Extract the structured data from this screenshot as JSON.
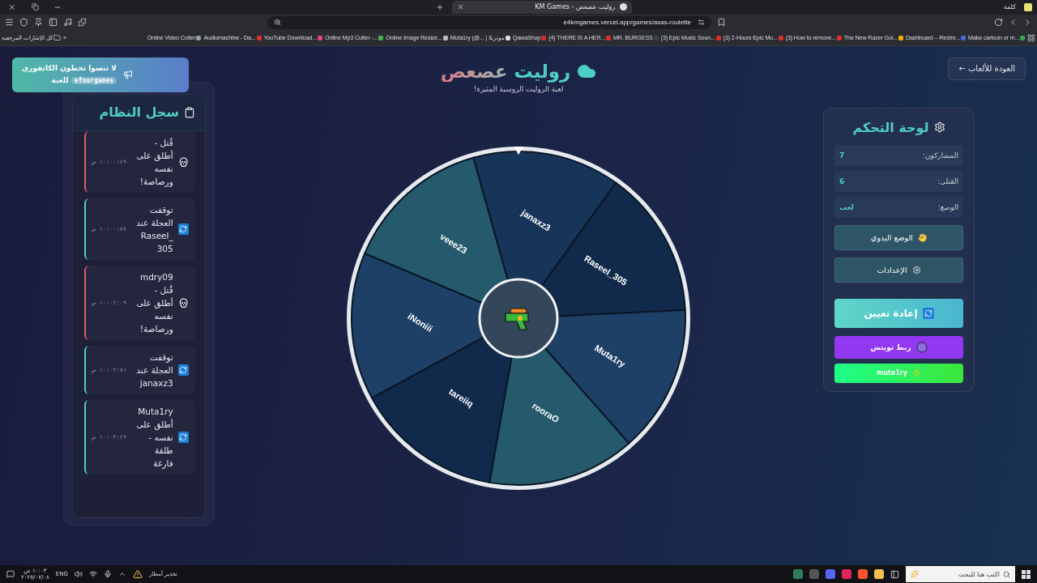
{
  "browser": {
    "tab_title": "روليت عصعص - KM Games",
    "app_label": "كلمة",
    "url": "e4kmgames.vercel.app/games/asas-roulette",
    "bookmarks_folder": "كل الإشارات المرجعية",
    "overflow": "»",
    "bookmarks": [
      {
        "label": "Make cartoon or m...",
        "color": "#34a853"
      },
      {
        "label": "Dashboard – Restre...",
        "color": "#3f6fd8"
      },
      {
        "label": "The New Razer Gol...",
        "color": "#f4b400"
      },
      {
        "label": "(3) How to remove...",
        "color": "#e52d27"
      },
      {
        "label": "(3) 2-Hours Epic Mu...",
        "color": "#e52d27"
      },
      {
        "label": "(3) Epic Music Soun...",
        "color": "#e52d27"
      },
      {
        "label": "MR. BURGESS",
        "color": "#37474f"
      },
      {
        "label": "(4) THERE IS A HER...",
        "color": "#e52d27"
      },
      {
        "label": "QawaShop",
        "color": "#d32f2f"
      },
      {
        "label": "Muta1ry (@... | موتريلا",
        "color": "#e0e0e0"
      },
      {
        "label": "Online Image Resize...",
        "color": "#bdbdbd"
      },
      {
        "label": "Online Mp3 Cutter -...",
        "color": "#4caf50"
      },
      {
        "label": "YouTube Download...",
        "color": "#e8467c"
      },
      {
        "label": "Audiomachine - Da...",
        "color": "#e52d27"
      },
      {
        "label": "Online Video Cutter",
        "color": "#9aa0a6"
      }
    ]
  },
  "toast": {
    "text": "لا تنسوا تحطون الكاتقوري",
    "code": "efourgames",
    "text_after": "للعبة"
  },
  "header": {
    "title_main": "روليت",
    "title_accent": "عصعص",
    "subtitle": "لعبة الروليت الروسية المثيرة!"
  },
  "back_button": "← العودة للألعاب",
  "log": {
    "title": "سجل النظام",
    "entries": [
      {
        "kind": "kill",
        "text": "قُتل - أطلق على نفسه ورصاصة!",
        "time": "١٠:٠٠:٤٩ ص"
      },
      {
        "kind": "spin",
        "text": "توقفت العجلة عند Raseel_305",
        "time": "١٠:٠٠:٥٥ ص"
      },
      {
        "kind": "kill",
        "text": "mdry09 قُتل - أطلق على نفسه ورصاصة!",
        "time": "١٠:٠٢:٠٩ ص"
      },
      {
        "kind": "spin",
        "text": "توقفت العجلة عند janaxz3",
        "time": "١٠:٠٢:٥١ ص"
      },
      {
        "kind": "spin",
        "text": "Muta1ry أطلق على نفسه - طلقة فارغة",
        "time": "١٠:٠٣:٢٧ ص"
      }
    ]
  },
  "wheel": {
    "segments": [
      {
        "name": "janaxz3",
        "color": "#173558"
      },
      {
        "name": "Raseel_305",
        "color": "#112a4b"
      },
      {
        "name": "Muta1ry",
        "color": "#1e3f66"
      },
      {
        "name": "rooraO",
        "color": "#245a6c"
      },
      {
        "name": "tareiiq",
        "color": "#112a4b"
      },
      {
        "name": "iNoniii",
        "color": "#1e3f66"
      },
      {
        "name": "veee23",
        "color": "#245a6c"
      }
    ]
  },
  "control_panel": {
    "title": "لوحة التحكم",
    "stats": [
      {
        "label": "المشاركون:",
        "value": "7"
      },
      {
        "label": "القتلى:",
        "value": "6"
      },
      {
        "label": "الوضع:",
        "value": "لعب"
      }
    ],
    "buttons": [
      {
        "kind": "manual",
        "label": "الوضع اليدوي"
      },
      {
        "kind": "settings",
        "label": "الإعدادات"
      },
      {
        "kind": "reset",
        "label": "إعادة تعيين"
      },
      {
        "kind": "twitch",
        "label": "ربط تويتش"
      },
      {
        "kind": "user",
        "label": "muta1ry"
      }
    ]
  },
  "taskbar": {
    "search_placeholder": "اكتب هنا للبحث",
    "weather": "تحذير أمطار",
    "language": "ENG",
    "time": "١٠:٠٣ ص",
    "date": "٢٠٢٥/٠٧/٠٨"
  }
}
